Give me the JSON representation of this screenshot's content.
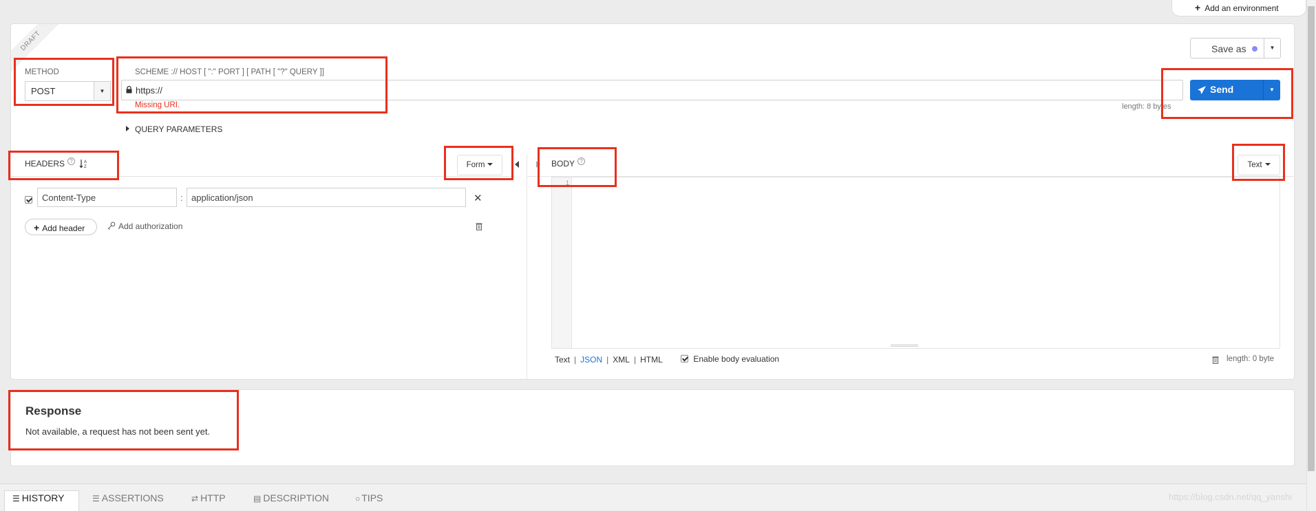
{
  "environment": {
    "add_label": "Add an environment"
  },
  "draft": {
    "ribbon": "DRAFT"
  },
  "request": {
    "method_label": "METHOD",
    "method_value": "POST",
    "url_label": "SCHEME :// HOST [ \":\" PORT ] [ PATH [ \"?\" QUERY ]]",
    "url_value": "https://",
    "url_error": "Missing URI.",
    "length": "length: 8 bytes",
    "save_as": "Save as",
    "send": "Send",
    "query_parameters": "QUERY PARAMETERS"
  },
  "headers": {
    "title": "HEADERS",
    "mode": "Form",
    "rows": [
      {
        "name": "Content-Type",
        "value": "application/json",
        "separator": ":"
      }
    ],
    "add_header": "Add header",
    "add_authorization": "Add authorization"
  },
  "body": {
    "title": "BODY",
    "mode": "Text",
    "line_number": "1",
    "formats": [
      "Text",
      "JSON",
      "XML",
      "HTML"
    ],
    "enable_evaluation": "Enable body evaluation",
    "length": "length: 0 byte"
  },
  "response": {
    "title": "Response",
    "message": "Not available, a request has not been sent yet."
  },
  "bottom_tabs": [
    "HISTORY",
    "ASSERTIONS",
    "HTTP",
    "DESCRIPTION",
    "TIPS"
  ],
  "watermark": "https://blog.csdn.net/qq_yanshi",
  "colors": {
    "accent": "#1a73d6",
    "error": "#e8301c",
    "annotation": "#e8301c",
    "save_dot": "#8b8df3"
  }
}
